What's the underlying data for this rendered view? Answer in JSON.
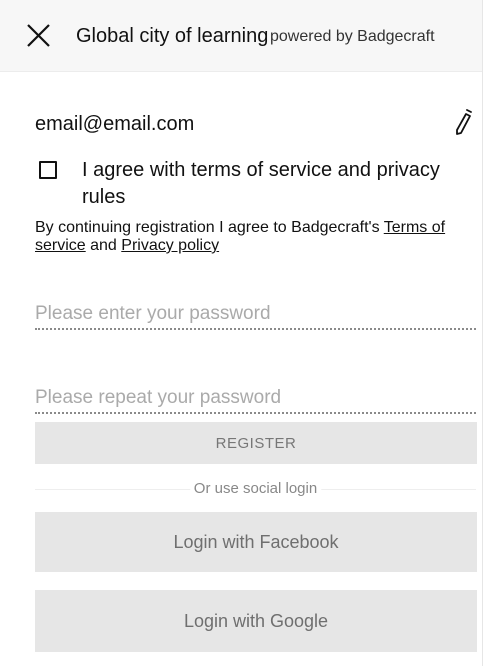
{
  "header": {
    "title": "Global city of learning",
    "subtitle": "powered by Badgecraft",
    "close_icon": "close-icon"
  },
  "account": {
    "email": "email@email.com",
    "edit_icon": "pencil-icon"
  },
  "agreement": {
    "checked": false,
    "label": "I agree with terms of service and privacy rules"
  },
  "terms_note": {
    "prefix": "By continuing registration I agree to Badgecraft's ",
    "terms_link": "Terms of service",
    "middle": " and ",
    "privacy_link": "Privacy policy"
  },
  "form": {
    "password_placeholder": "Please enter your password",
    "password_value": "",
    "repeat_placeholder": "Please repeat your password",
    "repeat_value": "",
    "register_label": "REGISTER"
  },
  "social": {
    "divider_label": "Or use social login",
    "facebook_label": "Login with Facebook",
    "google_label": "Login with Google"
  },
  "colors": {
    "header_bg": "#f7f7f7",
    "button_bg": "#e6e6e6",
    "placeholder": "#aaaaaa"
  }
}
